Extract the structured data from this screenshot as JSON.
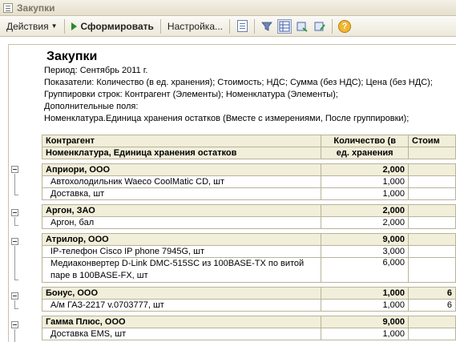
{
  "window": {
    "title": "Закупки"
  },
  "toolbar": {
    "actions_label": "Действия",
    "generate_label": "Сформировать",
    "settings_label": "Настройка..."
  },
  "report": {
    "title": "Закупки",
    "period": "Период: Сентябрь 2011 г.",
    "indicators": "Показатели: Количество (в ед. хранения); Стоимость; НДС; Сумма (без НДС); Цена (без НДС);",
    "grouping": "Группировки строк: Контрагент (Элементы); Номенклатура (Элементы);",
    "extra_fields": "Дополнительные поля:",
    "nomenclature_unit": "Номенклатура.Единица хранения остатков (Вместе с измерениями, После группировки);"
  },
  "table": {
    "header": {
      "col1_line1": "Контрагент",
      "col1_line2": "Номенклатура, Единица хранения остатков",
      "col2_line1": "Количество (в",
      "col2_line2": "ед. хранения",
      "col3": "Стоим"
    },
    "groups": [
      {
        "name": "Априори, ООО",
        "qty": "2,000",
        "extra": "",
        "items": [
          {
            "name": "Автохолодильник Waeco CoolMatic CD, шт",
            "qty": "1,000",
            "extra": ""
          },
          {
            "name": "Доставка, шт",
            "qty": "1,000",
            "extra": ""
          }
        ]
      },
      {
        "name": "Аргон, ЗАО",
        "qty": "2,000",
        "extra": "",
        "items": [
          {
            "name": "Аргон, бал",
            "qty": "2,000",
            "extra": ""
          }
        ]
      },
      {
        "name": "Атрилор, ООО",
        "qty": "9,000",
        "extra": "",
        "items": [
          {
            "name": "IP-телефон Cisco IP phone 7945G, шт",
            "qty": "3,000",
            "extra": ""
          },
          {
            "name": "Медиаконвертер D-Link DMC-515SC из 100BASE-TX по витой паре в 100BASE-FX, шт",
            "qty": "6,000",
            "extra": ""
          }
        ]
      },
      {
        "name": "Бонус, ООО",
        "qty": "1,000",
        "extra": "6",
        "items": [
          {
            "name": "А/м ГАЗ-2217 v.0703777, шт",
            "qty": "1,000",
            "extra": "6"
          }
        ]
      },
      {
        "name": "Гамма Плюс, ООО",
        "qty": "9,000",
        "extra": "",
        "items": [
          {
            "name": "Доставка EMS, шт",
            "qty": "1,000",
            "extra": ""
          }
        ]
      }
    ]
  }
}
